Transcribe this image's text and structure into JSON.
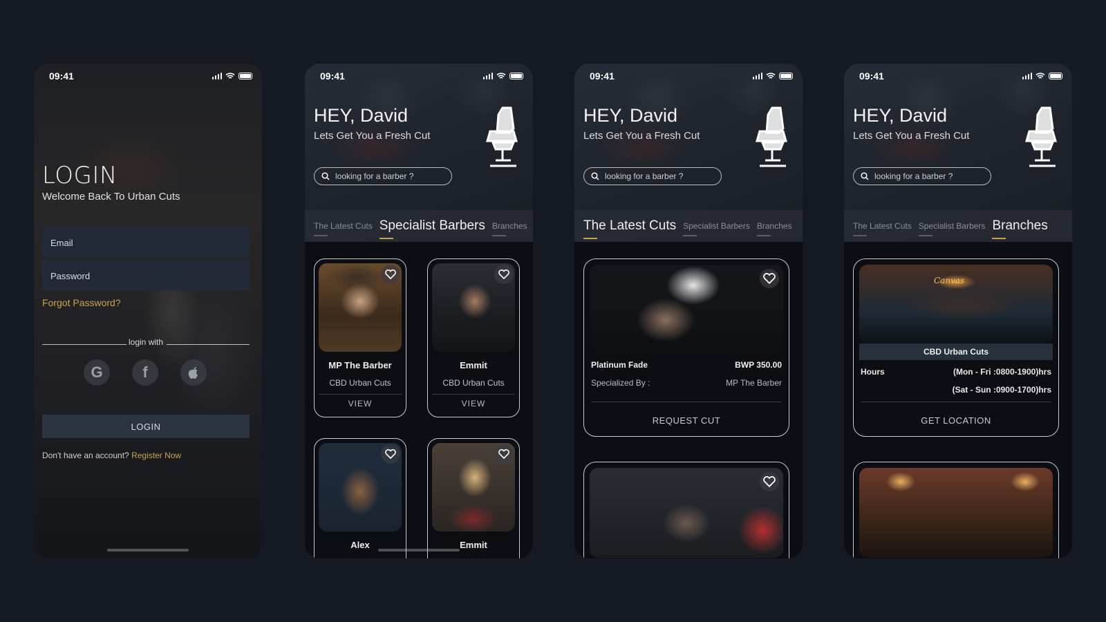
{
  "status": {
    "time": "09:41"
  },
  "login": {
    "title": "LOGIN",
    "subtitle": "Welcome Back To Urban Cuts",
    "email_placeholder": "Email",
    "password_placeholder": "Password",
    "forgot": "Forgot Password?",
    "login_with": "login with",
    "button": "LOGIN",
    "no_account": "Don't have an account?",
    "register": "Register Now"
  },
  "header": {
    "greeting": "HEY, David",
    "tagline": "Lets Get You a Fresh Cut",
    "search_placeholder": "looking for a barber ?"
  },
  "tabs": [
    "The Latest Cuts",
    "Specialist Barbers",
    "Branches"
  ],
  "barbers": [
    {
      "name": "MP The Barber",
      "branch": "CBD Urban Cuts",
      "action": "VIEW"
    },
    {
      "name": "Emmit",
      "branch": "CBD Urban Cuts",
      "action": "VIEW"
    },
    {
      "name": "Alex"
    },
    {
      "name": "Emmit"
    }
  ],
  "cut": {
    "name": "Platinum Fade",
    "price": "BWP 350.00",
    "specialized_label": "Specialized By :",
    "specialized_value": "MP The Barber",
    "action": "REQUEST CUT"
  },
  "branch": {
    "name": "CBD Urban Cuts",
    "hours_label": "Hours",
    "weekday": "(Mon - Fri :0800-1900)hrs",
    "weekend": "(Sat - Sun :0900-1700)hrs",
    "action": "GET LOCATION",
    "sign": "Canvas"
  },
  "colors": {
    "accent": "#c9a34f",
    "background": "#141922",
    "card_border": "#c9ccd2"
  }
}
